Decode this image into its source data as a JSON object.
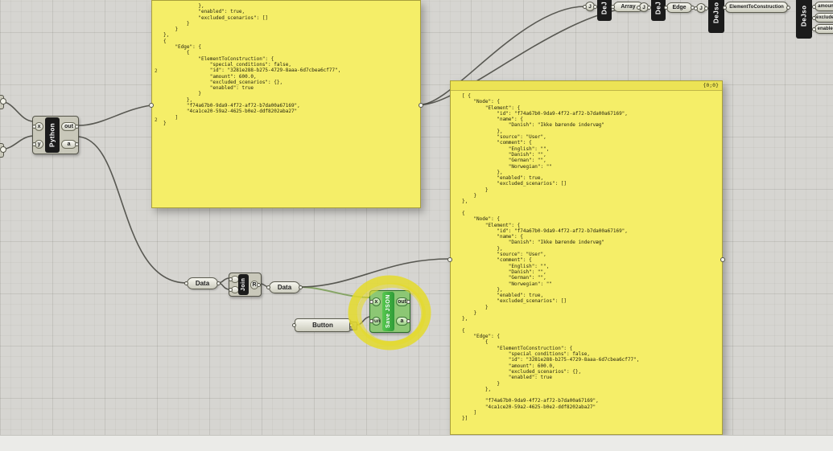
{
  "panel_left": {
    "gutter_mid": "2",
    "gutter_bottom": "2",
    "text": "            },\n            \"enabled\": true,\n            \"excluded_scenarios\": []\n        }\n    }\n},\n{\n    \"Edge\": {\n        {\n            \"ElementToConstruction\": {\n                \"special_conditions\": false,\n                \"id\": \"3281e288-b275-4729-8aaa-6d7cbea6cf77\",\n                \"amount\": 600.0,\n                \"excluded_scenarios\": {},\n                \"enabled\": true\n            }\n        },\n        \"f74a67b0-9da9-4f72-af72-b7da00a67169\",\n        \"4ca1ce20-59a2-4625-b0e2-ddf8202aba27\"\n    ]\n}"
  },
  "panel_right": {
    "header": "{0;0}",
    "text": "[ {\n    \"Node\": {\n        \"Element\": {\n            \"id\": \"f74a67b0-9da9-4f72-af72-b7da00a67169\",\n            \"name\": {\n                \"Danish\": \"Ikke bærende indervæg\"\n            },\n            \"source\": \"User\",\n            \"comment\": {\n                \"English\": \"\",\n                \"Danish\": \"\",\n                \"German\": \"\",\n                \"Norwegian\": \"\"\n            },\n            \"enabled\": true,\n            \"excluded_scenarios\": []\n        }\n    }\n},\n\n{\n    \"Node\": {\n        \"Element\": {\n            \"id\": \"f74a67b0-9da9-4f72-af72-b7da00a67169\",\n            \"name\": {\n                \"Danish\": \"Ikke bærende indervæg\"\n            },\n            \"source\": \"User\",\n            \"comment\": {\n                \"English\": \"\",\n                \"Danish\": \"\",\n                \"German\": \"\",\n                \"Norwegian\": \"\"\n            },\n            \"enabled\": true,\n            \"excluded_scenarios\": []\n        }\n    }\n},\n\n{\n    \"Edge\": {\n        {\n            \"ElementToConstruction\": {\n                \"special_conditions\": false,\n                \"id\": \"3281e288-b275-4729-8aaa-6d7cbea6cf77\",\n                \"amount\": 600.0,\n                \"excluded_scenarios\": {},\n                \"enabled\": true\n            }\n        },\n\n        \"f74a67b0-9da9-4f72-af72-b7da00a67169\",\n        \"4ca1ce20-59a2-4625-b0e2-ddf8202aba27\"\n    ]\n}]"
  },
  "nodes": {
    "python": {
      "label": "Python",
      "inputs": [
        "x",
        "y"
      ],
      "outputs": [
        "out",
        "a"
      ]
    },
    "data1": {
      "label": "Data"
    },
    "join": {
      "label": "Join",
      "inputs": [
        "",
        ""
      ],
      "outputs": [
        "R"
      ]
    },
    "data2": {
      "label": "Data"
    },
    "button": {
      "label": "Button"
    },
    "save_json": {
      "label": "Save JSON",
      "inputs": [
        "x",
        "run"
      ],
      "outputs": [
        "out",
        "a"
      ]
    },
    "dej_array": {
      "label": "DeJ",
      "input": "J",
      "output": "Array"
    },
    "dej_edge": {
      "label": "DeJ",
      "input": "J",
      "output": "Edge"
    },
    "dejso_etc": {
      "label": "DeJso",
      "input": "J",
      "output": "ElementToConstruction"
    },
    "dejso_right": {
      "label": "DeJso",
      "outputs": [
        "amount",
        "excluded",
        "enabled"
      ]
    }
  }
}
